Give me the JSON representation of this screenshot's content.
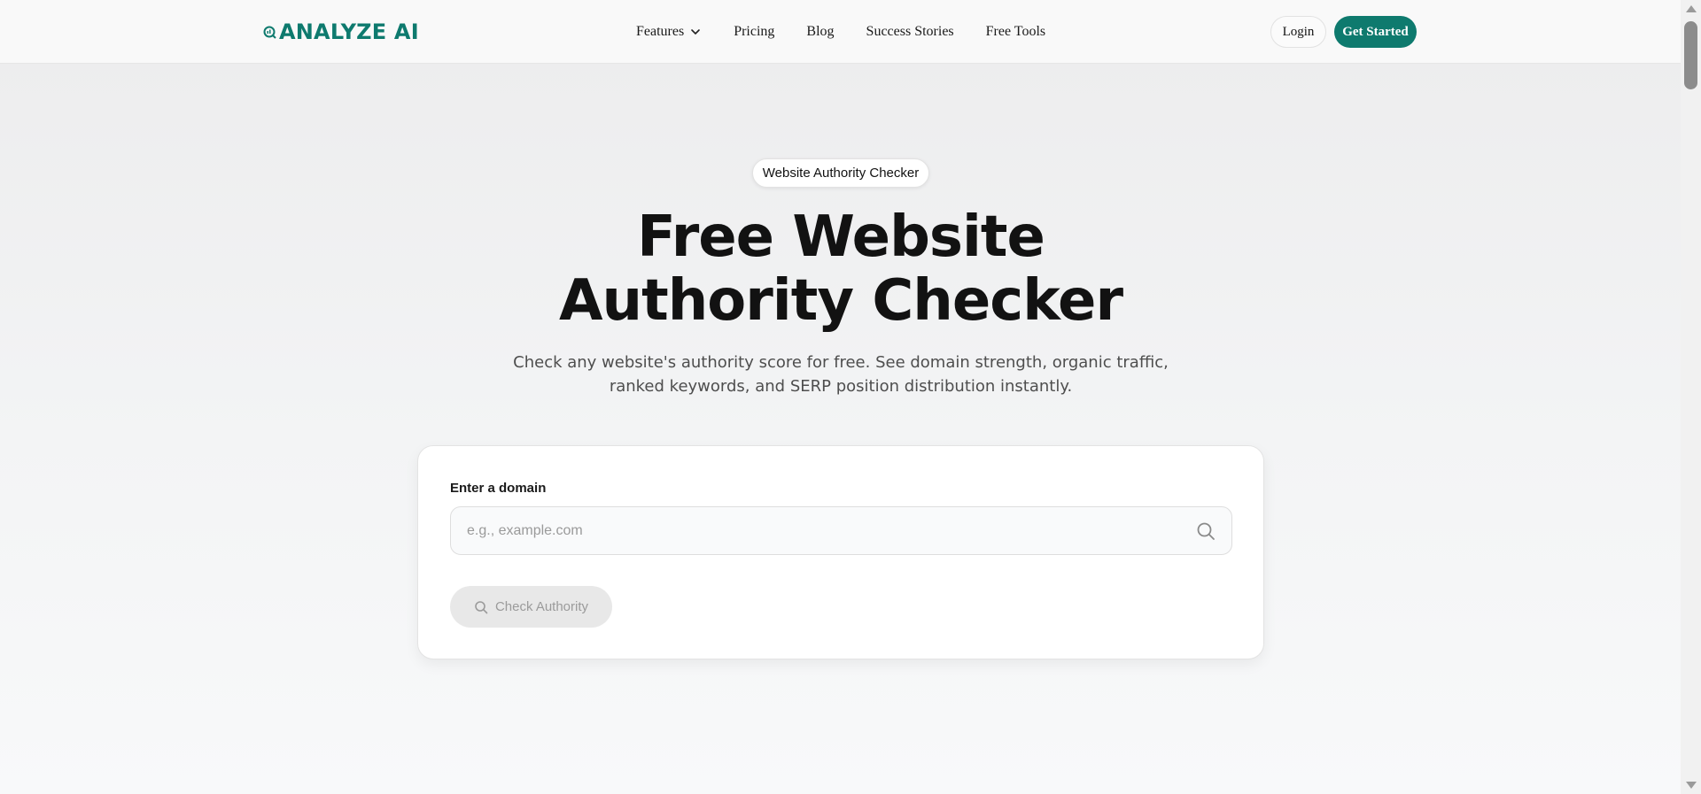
{
  "header": {
    "logo_text": "ANALYZE AI",
    "brand_color": "#0e7a6e",
    "nav": [
      {
        "label": "Features",
        "has_dropdown": true
      },
      {
        "label": "Pricing"
      },
      {
        "label": "Blog"
      },
      {
        "label": "Success Stories"
      },
      {
        "label": "Free Tools"
      }
    ],
    "login_label": "Login",
    "get_started_label": "Get Started"
  },
  "hero": {
    "badge": "Website Authority Checker",
    "title": "Free Website Authority Checker",
    "subtitle": "Check any website's authority score for free. See domain strength, organic traffic, ranked keywords, and SERP position distribution instantly."
  },
  "form": {
    "label": "Enter a domain",
    "placeholder": "e.g., example.com",
    "value": "",
    "button_label": "Check Authority",
    "button_icon": "search-icon",
    "input_icon": "search-icon"
  }
}
